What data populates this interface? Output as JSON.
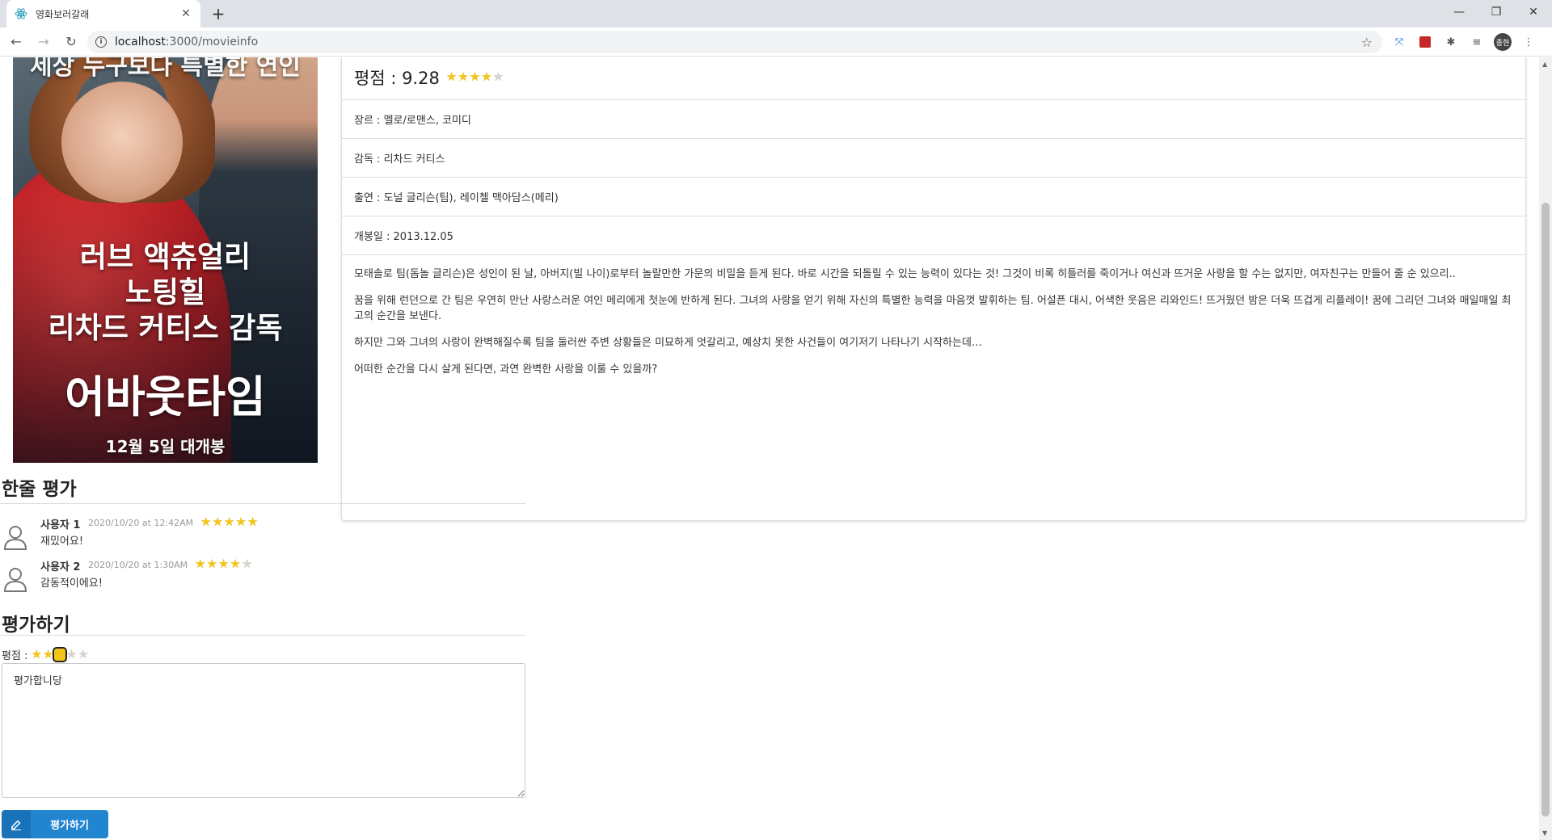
{
  "browser": {
    "tab_title": "영화보러갈래",
    "url_host": "localhost",
    "url_path": ":3000/movieinfo",
    "profile_initials": "종현"
  },
  "poster": {
    "top_text": "세상 누구보다 특별한 연인",
    "line1": "러브 액츄얼리",
    "line2": "노팅힐",
    "line3": "리차드 커티스 감독",
    "title": "어바웃타임",
    "release_text": "12월 5일 대개봉"
  },
  "movie": {
    "rating_label": "평점 : 9.28",
    "rating_stars": 4,
    "genre": "장르 : 멜로/로맨스, 코미디",
    "director": "감독 : 리차드 커티스",
    "cast": "출연 : 도널 글리슨(팀), 레이첼 맥아담스(메리)",
    "release": "개봉일 : 2013.12.05",
    "description": [
      "모태솔로 팀(돔놀 글리슨)은 성인이 된 날, 아버지(빌 나이)로부터 놀랄만한 가문의 비밀을 듣게 된다. 바로 시간을 되돌릴 수 있는 능력이 있다는 것! 그것이 비록 히틀러를 죽이거나 여신과 뜨거운 사랑을 할 수는 없지만, 여자친구는 만들어 줄 순 있으리..",
      "꿈을 위해 런던으로 간 팀은 우연히 만난 사랑스러운 여인 메리에게 첫눈에 반하게 된다. 그녀의 사랑을 얻기 위해 자신의 특별한 능력을 마음껏 발휘하는 팀. 어설픈 대시, 어색한 웃음은 리와인드! 뜨거웠던 밤은 더욱 뜨겁게 리플레이! 꿈에 그리던 그녀와 매일매일 최고의 순간을 보낸다.",
      "하지만 그와 그녀의 사랑이 완벽해질수록 팀을 둘러싼 주변 상황들은 미묘하게 엇갈리고, 예상치 못한 사건들이 여기저기 나타나기 시작하는데…",
      "어떠한 순간을 다시 살게 된다면, 과연 완벽한 사랑을 이룰 수 있을까?"
    ]
  },
  "reviews": {
    "section_title": "한줄 평가",
    "items": [
      {
        "author": "사용자 1",
        "date": "2020/10/20 at 12:42AM",
        "stars": 5,
        "text": "재밌어요!"
      },
      {
        "author": "사용자 2",
        "date": "2020/10/20 at 1:30AM",
        "stars": 4,
        "text": "감동적이에요!"
      }
    ]
  },
  "rate_form": {
    "section_title": "평가하기",
    "rating_label": "평점 :",
    "selected_stars": 3,
    "textarea_value": "평가합니당",
    "submit_label": "평가하기"
  },
  "colors": {
    "star_on": "#f5c518",
    "star_off": "#d4d4d4",
    "button": "#2185d0"
  }
}
